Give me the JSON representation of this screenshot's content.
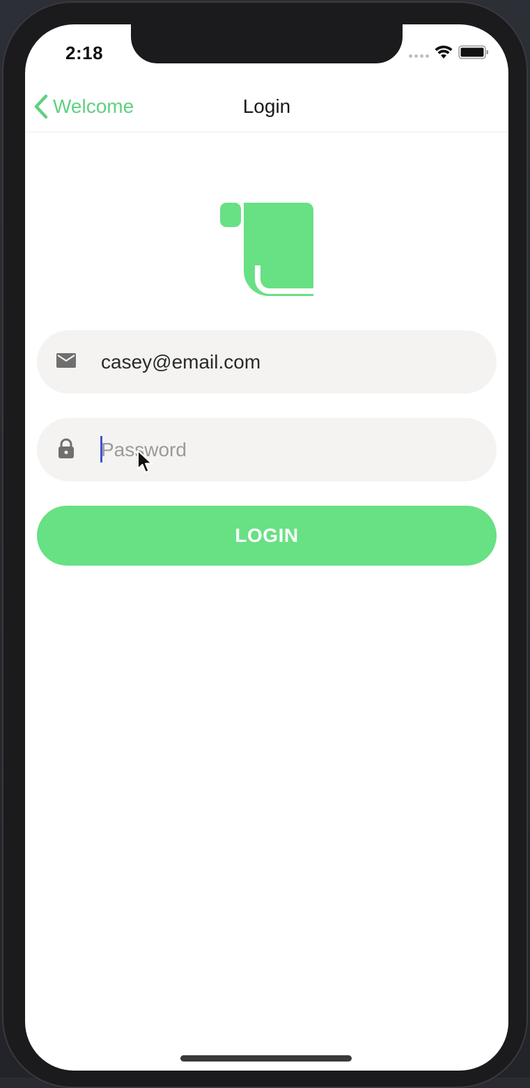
{
  "status_bar": {
    "time": "2:18"
  },
  "nav": {
    "back_label": "Welcome",
    "title": "Login"
  },
  "logo": {
    "icon": "scroll-icon",
    "color": "#68e084"
  },
  "email_field": {
    "icon": "mail-icon",
    "value": "casey@email.com"
  },
  "password_field": {
    "icon": "lock-icon",
    "value": "",
    "placeholder": "Password",
    "focused": true
  },
  "login_button": {
    "label": "LOGIN",
    "color": "#68e084"
  },
  "colors": {
    "accent": "#5fd080",
    "field_background": "#f4f3f2",
    "caret": "#3d54d9"
  }
}
